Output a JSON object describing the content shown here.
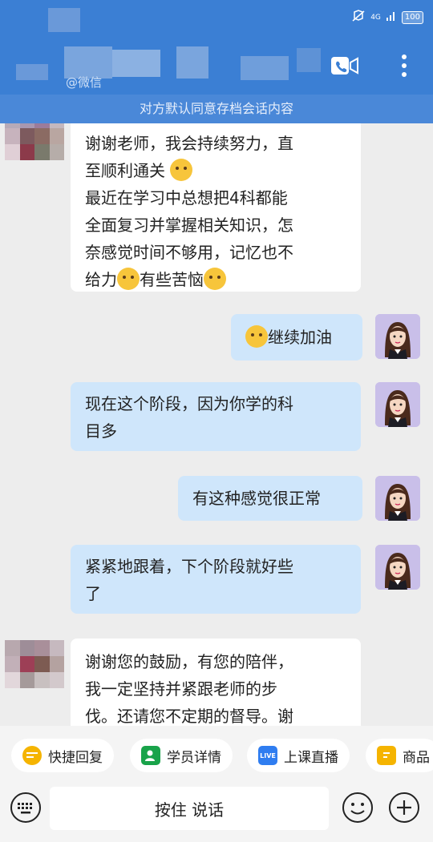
{
  "status": {
    "signal": "4G",
    "battery": "100"
  },
  "header": {
    "subtitle": "@微信",
    "call_icon": "video-call-icon",
    "more_icon": "more-vertical-icon"
  },
  "notice": "对方默认同意存档会话内容",
  "messages": [
    {
      "side": "left",
      "lines": [
        "谢谢老师，我会持续努力，直",
        "至顺利通关",
        "最近在学习中总想把4科都能",
        "全面复习并掌握相关知识，怎",
        "奈感觉时间不够用，记忆也不",
        "给力",
        "有些苦恼"
      ]
    },
    {
      "side": "right",
      "text": "继续加油"
    },
    {
      "side": "right",
      "lines": [
        "现在这个阶段，因为你学的科",
        "目多"
      ]
    },
    {
      "side": "right",
      "text": "有这种感觉很正常"
    },
    {
      "side": "right",
      "lines": [
        "紧紧地跟着，下个阶段就好些",
        "了"
      ]
    },
    {
      "side": "left",
      "lines": [
        "谢谢您的鼓励，有您的陪伴，",
        "我一定坚持并紧跟老师的步",
        "伐。还请您不定期的督导。谢"
      ]
    }
  ],
  "quick_actions": [
    {
      "label": "快捷回复",
      "icon": "quick-reply-icon",
      "color": "#f5b400"
    },
    {
      "label": "学员详情",
      "icon": "student-icon",
      "color": "#19a34a"
    },
    {
      "label": "上课直播",
      "icon": "live-icon",
      "color": "#2f7df0",
      "icon_text": "LIVE"
    },
    {
      "label": "商品",
      "icon": "goods-icon",
      "color": "#f5b400"
    }
  ],
  "input": {
    "talk_label": "按住 说话",
    "keyboard_icon": "keyboard-icon",
    "emoji_icon": "emoji-icon",
    "plus_icon": "plus-icon"
  },
  "colors": {
    "header": "#3b7fd4",
    "bubble_right": "#cfe6fb",
    "bubble_left": "#ffffff"
  }
}
